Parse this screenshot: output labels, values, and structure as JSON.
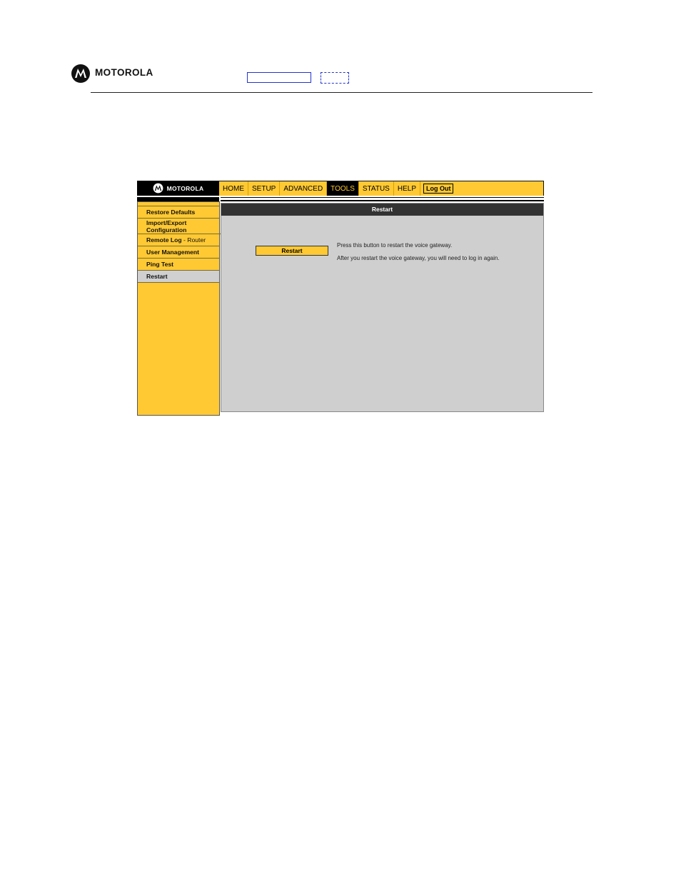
{
  "doc_header": {
    "brand": "MOTOROLA"
  },
  "ui": {
    "brand": "MOTOROLA",
    "nav": {
      "tabs": [
        {
          "label": "HOME"
        },
        {
          "label": "SETUP"
        },
        {
          "label": "ADVANCED"
        },
        {
          "label": "TOOLS",
          "active": true
        },
        {
          "label": "STATUS"
        },
        {
          "label": "HELP"
        }
      ],
      "logout": "Log Out"
    },
    "sidebar": {
      "items": [
        {
          "label": "Restore Defaults"
        },
        {
          "label": "Import/Export Configuration"
        },
        {
          "label": "Remote Log",
          "sub": " - Router"
        },
        {
          "label": "User Management"
        },
        {
          "label": "Ping Test"
        },
        {
          "label": "Restart",
          "active": true
        }
      ]
    },
    "content": {
      "title": "Restart",
      "button_label": "Restart",
      "description_1": "Press this button to restart the voice gateway.",
      "description_2": "After you restart the voice gateway, you will need to log in again."
    }
  },
  "colors": {
    "accent": "#ffc933",
    "active_tab_bg": "#000000",
    "content_bg": "#cfcfcf",
    "title_bar_bg": "#333333"
  }
}
